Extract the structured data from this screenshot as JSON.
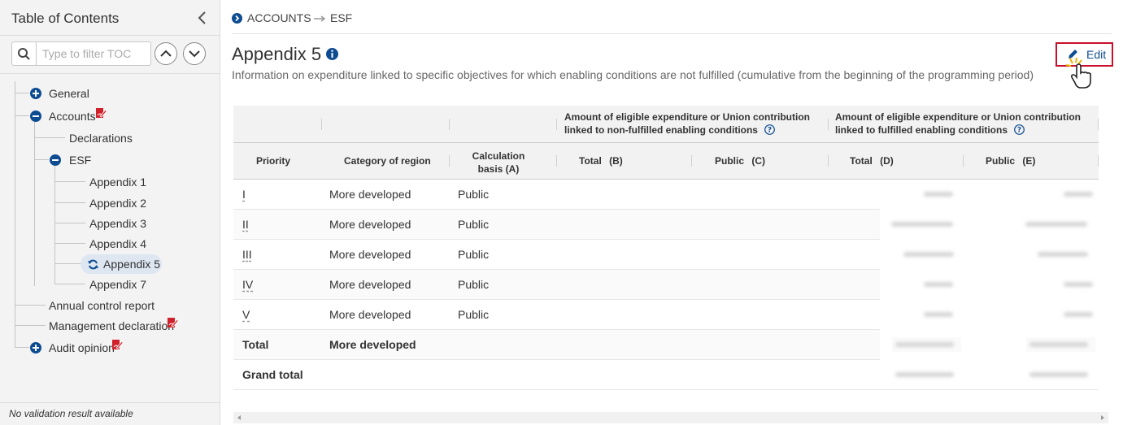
{
  "sidebar": {
    "title": "Table of Contents",
    "filter_placeholder": "Type to filter TOC",
    "tree": {
      "general": "General",
      "accounts": "Accounts",
      "declarations": "Declarations",
      "esf": "ESF",
      "appendices": [
        "Appendix 1",
        "Appendix 2",
        "Appendix 3",
        "Appendix 4",
        "Appendix 5",
        "Appendix 7"
      ],
      "annual_control_report": "Annual control report",
      "management_declaration": "Management declaration",
      "audit_opinion": "Audit opinion"
    },
    "validation_text": "No validation result available"
  },
  "breadcrumb": {
    "root": "ACCOUNTS",
    "current": "ESF"
  },
  "page": {
    "title": "Appendix 5",
    "description": "Information on expenditure linked to specific objectives for which enabling conditions are not fulfilled (cumulative from the beginning of the programming period)",
    "edit_label": "Edit"
  },
  "table": {
    "group_headers": {
      "non_fulfilled": "Amount of eligible expenditure or Union contribution linked to non-fulfilled enabling conditions",
      "fulfilled": "Amount of eligible expenditure or Union contribution linked to fulfilled enabling conditions"
    },
    "columns": {
      "priority": "Priority",
      "category": "Category of region",
      "basis": "Calculation basis (A)",
      "total_b": "Total (B)",
      "public_c": "Public (C)",
      "total_d": "Total (D)",
      "public_e": "Public (E)"
    },
    "rows": [
      {
        "priority": "I",
        "category": "More developed",
        "basis": "Public"
      },
      {
        "priority": "II",
        "category": "More developed",
        "basis": "Public"
      },
      {
        "priority": "III",
        "category": "More developed",
        "basis": "Public"
      },
      {
        "priority": "IV",
        "category": "More developed",
        "basis": "Public"
      },
      {
        "priority": "V",
        "category": "More developed",
        "basis": "Public"
      }
    ],
    "total_row": {
      "label": "Total",
      "category": "More developed"
    },
    "grand_total_label": "Grand total"
  },
  "colors": {
    "accent": "#0e4c92",
    "edit_border": "#c8102e",
    "signature_red": "#d0202a"
  }
}
